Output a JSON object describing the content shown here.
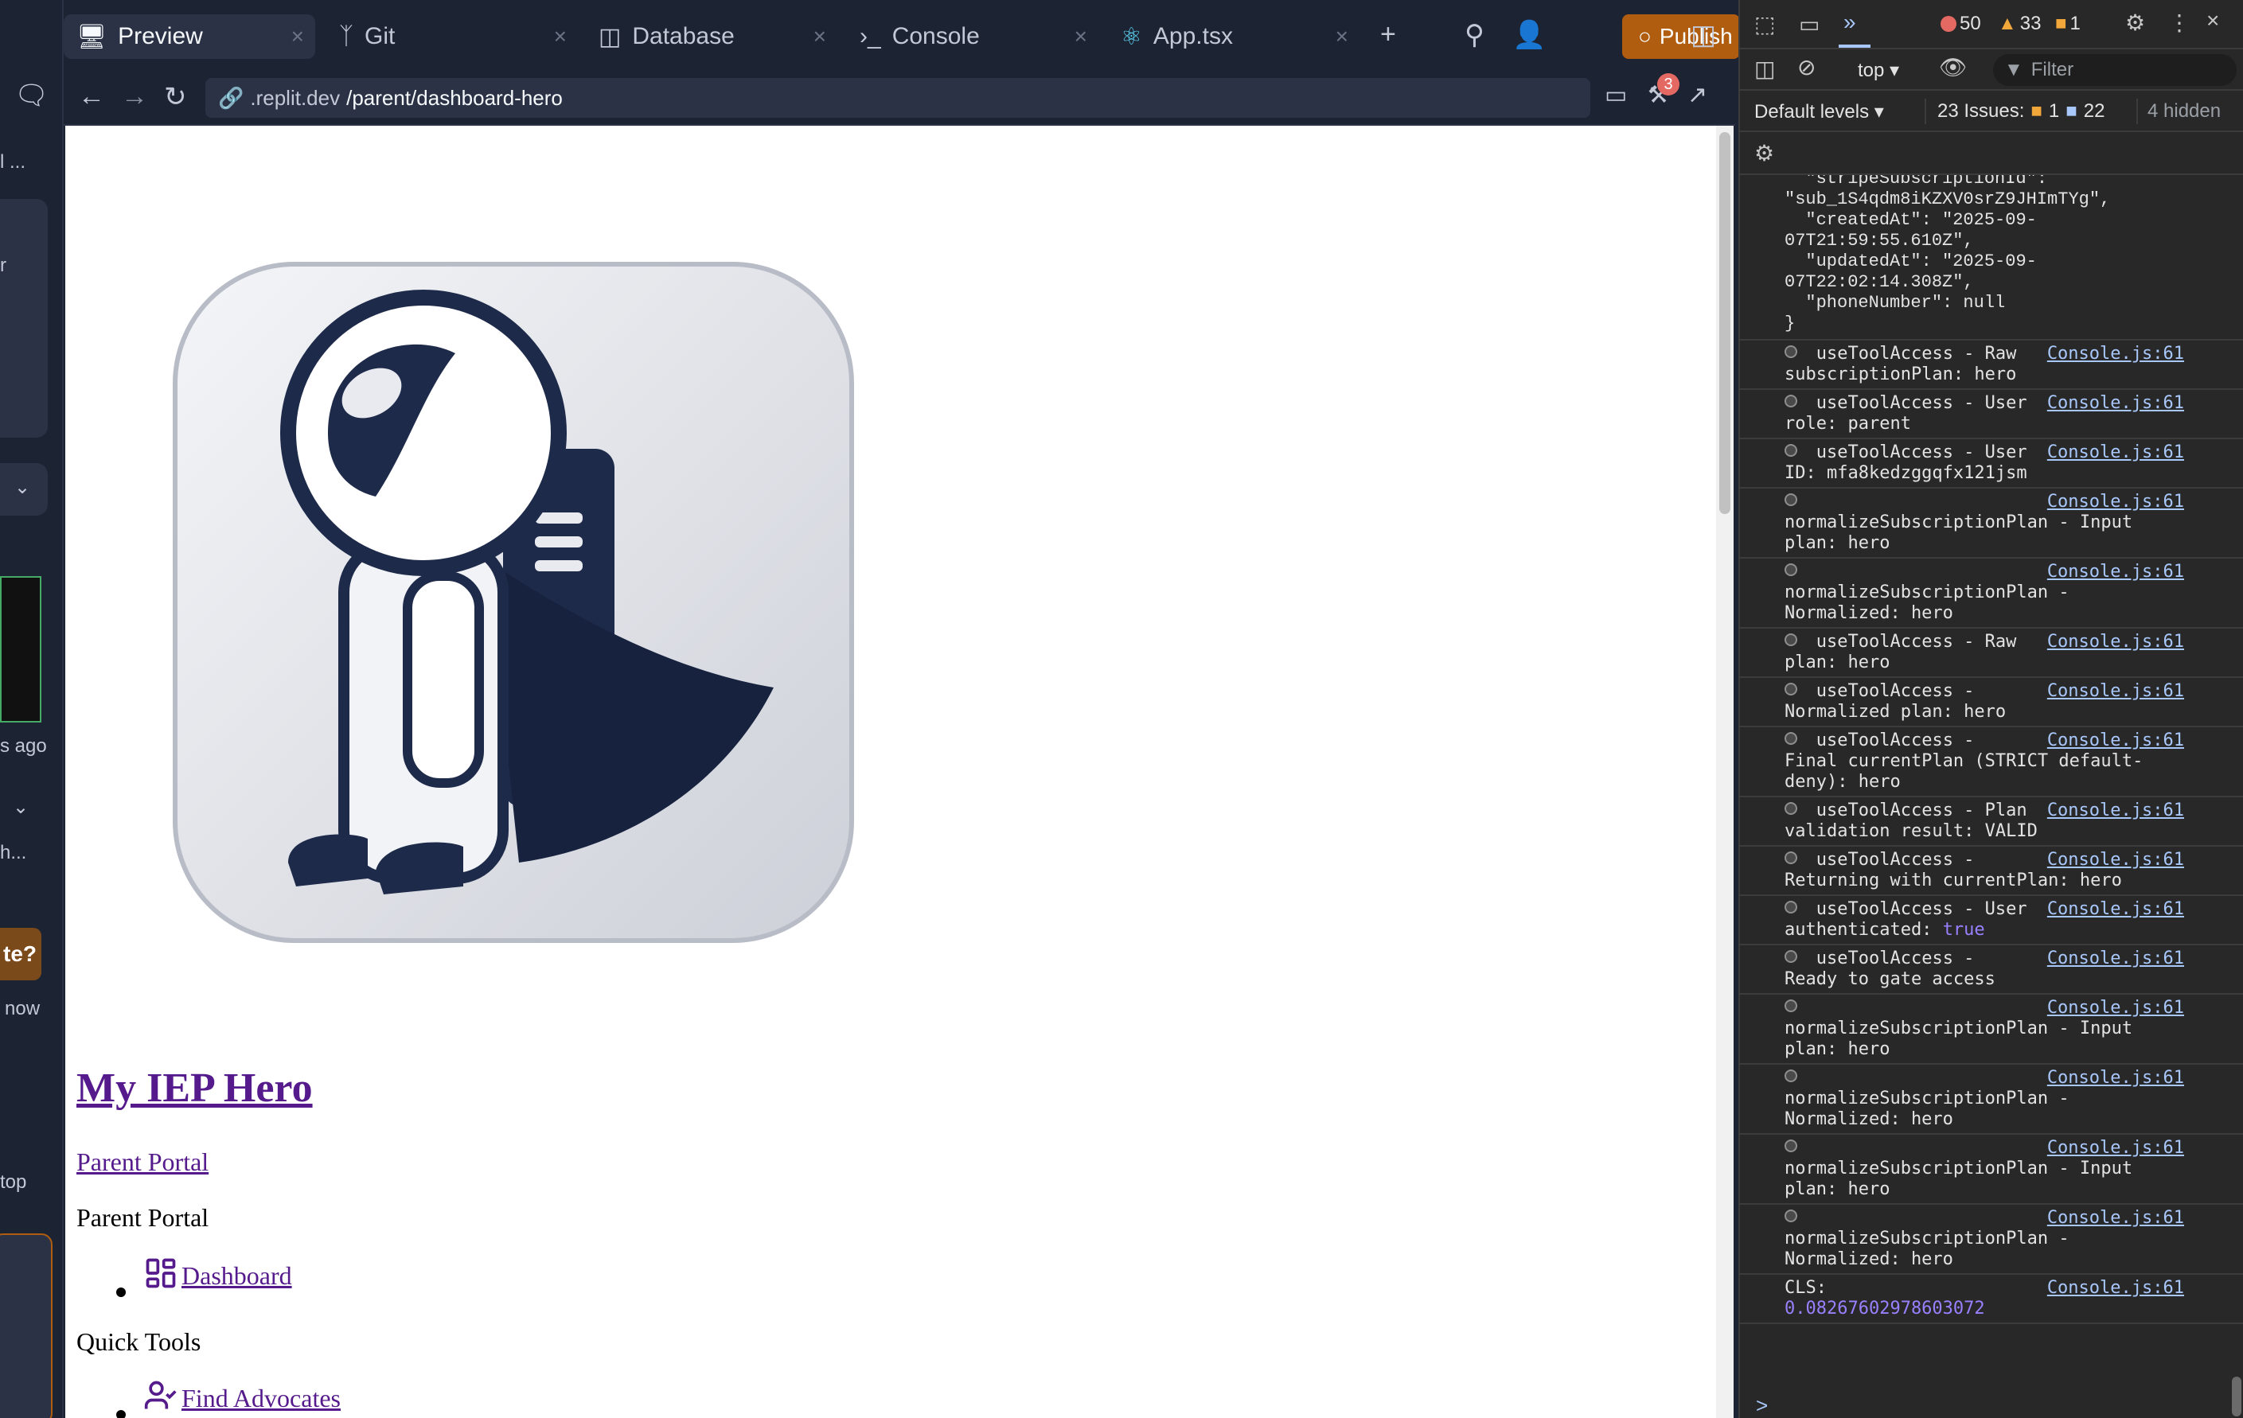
{
  "leftbar": {
    "fragments": [
      "l ...",
      "r",
      "s ago",
      "h...",
      "te?",
      "now",
      "top"
    ]
  },
  "tabs": [
    {
      "label": "Preview",
      "icon": "monitor-icon",
      "active": true
    },
    {
      "label": "Git",
      "icon": "git-branch-icon",
      "active": false
    },
    {
      "label": "Database",
      "icon": "database-icon",
      "active": false
    },
    {
      "label": "Console",
      "icon": "terminal-icon",
      "active": false
    },
    {
      "label": "App.tsx",
      "icon": "react-icon",
      "active": false
    }
  ],
  "toolbar": {
    "publish_label": "Publish"
  },
  "url": {
    "prefix": ".replit.dev",
    "path": "/parent/dashboard-hero",
    "notification_count": "3"
  },
  "page": {
    "title": "My IEP Hero",
    "link_parent_portal": "Parent Portal",
    "text_parent_portal": "Parent Portal",
    "nav_dashboard": "Dashboard",
    "quick_tools": "Quick Tools",
    "nav_find_advocates": "Find Advocates"
  },
  "devtools": {
    "error_count": "50",
    "warning_count": "33",
    "issue_count_badge": "1",
    "context": "top",
    "filter_placeholder": "Filter",
    "levels": "Default levels",
    "issues_label": "23 Issues:",
    "issues_warn": "1",
    "issues_info": "22",
    "hidden": "4 hidden",
    "json_tail": "  \"stripeSubscriptionId\":\n\"sub_1S4qdm8iKZXV0srZ9JHImTYg\",\n  \"createdAt\": \"2025-09-\n07T21:59:55.610Z\",\n  \"updatedAt\": \"2025-09-\n07T22:02:14.308Z\",\n  \"phoneNumber\": null\n}",
    "messages": [
      {
        "text": "   useToolAccess - Raw\nsubscriptionPlan: hero",
        "source": "Console.js:61"
      },
      {
        "text": "   useToolAccess - User\nrole: parent",
        "source": "Console.js:61"
      },
      {
        "text": "   useToolAccess - User\nID: mfa8kedzggqfx121jsm",
        "source": "Console.js:61"
      },
      {
        "text": "\nnormalizeSubscriptionPlan - Input\nplan: hero",
        "source": "Console.js:61"
      },
      {
        "text": "\nnormalizeSubscriptionPlan -\nNormalized: hero",
        "source": "Console.js:61"
      },
      {
        "text": "   useToolAccess - Raw\nplan: hero",
        "source": "Console.js:61"
      },
      {
        "text": "   useToolAccess -\nNormalized plan: hero",
        "source": "Console.js:61"
      },
      {
        "text": "   useToolAccess -\nFinal currentPlan (STRICT default-\ndeny): hero",
        "source": "Console.js:61"
      },
      {
        "text": "   useToolAccess - Plan\nvalidation result: VALID",
        "source": "Console.js:61"
      },
      {
        "text": "   useToolAccess -\nReturning with currentPlan: hero",
        "source": "Console.js:61"
      },
      {
        "text": "   useToolAccess - User\nauthenticated: ",
        "keyword": "true",
        "source": "Console.js:61"
      },
      {
        "text": "   useToolAccess -\nReady to gate access",
        "source": "Console.js:61"
      },
      {
        "text": "\nnormalizeSubscriptionPlan - Input\nplan: hero",
        "source": "Console.js:61"
      },
      {
        "text": "\nnormalizeSubscriptionPlan -\nNormalized: hero",
        "source": "Console.js:61"
      },
      {
        "text": "\nnormalizeSubscriptionPlan - Input\nplan: hero",
        "source": "Console.js:61"
      },
      {
        "text": "\nnormalizeSubscriptionPlan -\nNormalized: hero",
        "source": "Console.js:61"
      },
      {
        "text": "CLS:\n",
        "keyword": "0.08267602978603072",
        "source": "Console.js:61",
        "no_icon": true
      }
    ],
    "prompt": ">"
  },
  "colors": {
    "accent_publish": "#b05d0f",
    "link": "#551a8b",
    "error": "#e46962",
    "warning": "#f2a73b"
  }
}
